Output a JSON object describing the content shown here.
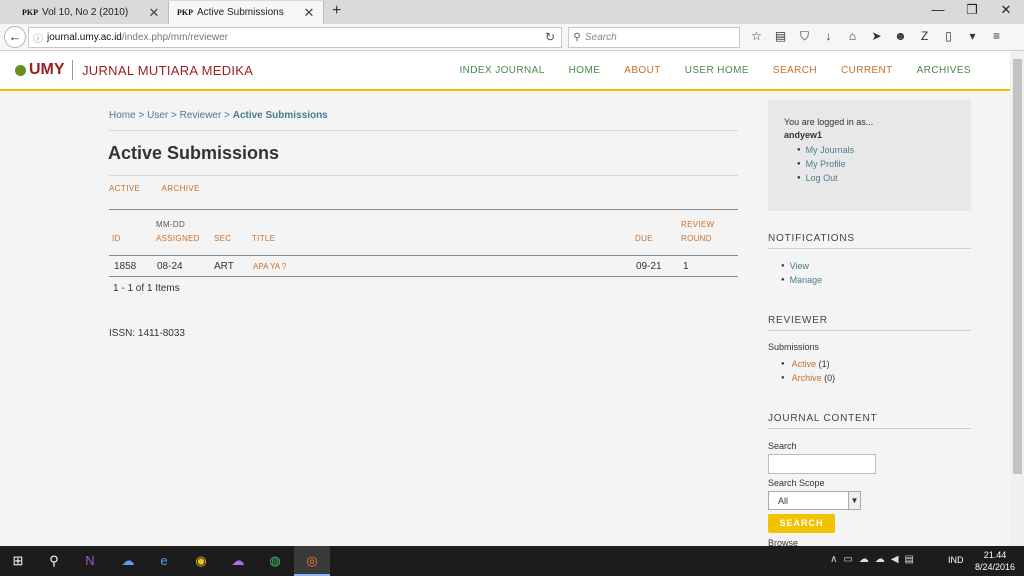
{
  "browser": {
    "tabs": [
      {
        "label": "Vol 10, No 2 (2010)",
        "icon": "PKP"
      },
      {
        "label": "Active Submissions",
        "icon": "PKP"
      }
    ],
    "url_host": "journal.umy.ac.id",
    "url_path": "/index.php/mm/reviewer",
    "search_placeholder": "Search"
  },
  "site": {
    "logo_text": "UMY",
    "journal_name": "JURNAL MUTIARA MEDIKA",
    "nav": [
      "INDEX JOURNAL",
      "HOME",
      "ABOUT",
      "USER HOME",
      "SEARCH",
      "CURRENT",
      "ARCHIVES"
    ]
  },
  "breadcrumb": {
    "home": "Home",
    "user": "User",
    "reviewer": "Reviewer",
    "current": "Active Submissions",
    "sep": ">"
  },
  "page_title": "Active Submissions",
  "subtabs": [
    "ACTIVE",
    "ARCHIVE"
  ],
  "table": {
    "headers": {
      "id": "ID",
      "assigned_top": "MM-DD",
      "assigned": "ASSIGNED",
      "sec": "SEC",
      "title": "TITLE",
      "due": "DUE",
      "round_top": "REVIEW",
      "round": "ROUND"
    },
    "rows": [
      {
        "id": "1858",
        "assigned": "08-24",
        "sec": "ART",
        "title": "APA YA ?",
        "due": "09-21",
        "round": "1"
      }
    ],
    "items_label": "1 - 1 of 1 Items"
  },
  "issn": "ISSN: 1411-8033",
  "sidebar": {
    "logged_in_label": "You are logged in as...",
    "username": "andyew1",
    "user_links": [
      "My Journals",
      "My Profile",
      "Log Out"
    ],
    "notifications_title": "NOTIFICATIONS",
    "notifications_links": [
      "View",
      "Manage"
    ],
    "reviewer_title": "REVIEWER",
    "submissions_label": "Submissions",
    "active_link": "Active",
    "active_count": "(1)",
    "archive_link": "Archive",
    "archive_count": "(0)",
    "journal_content_title": "JOURNAL CONTENT",
    "search_label": "Search",
    "search_scope_label": "Search Scope",
    "search_scope_value": "All",
    "search_button": "SEARCH",
    "browse_label": "Browse"
  },
  "taskbar": {
    "language": "IND",
    "time": "21.44",
    "date": "8/24/2016"
  }
}
